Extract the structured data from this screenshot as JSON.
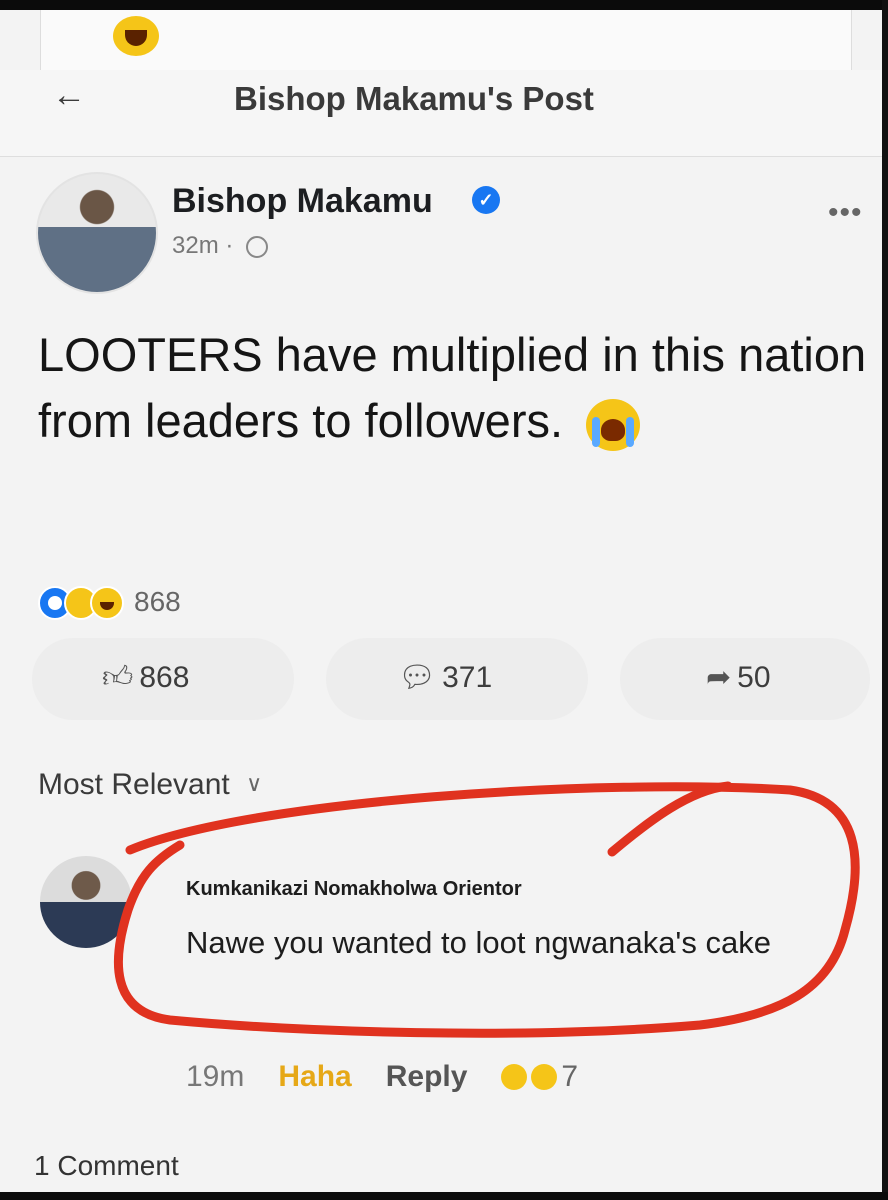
{
  "header": {
    "title": "Bishop Makamu's Post"
  },
  "post": {
    "author": "Bishop Makamu",
    "time": "32m",
    "separator": "·",
    "text": "LOOTERS have multiplied in this nation from leaders to followers.",
    "reaction_count": "868",
    "actions": {
      "like_count": "868",
      "comment_count": "371",
      "share_count": "50"
    }
  },
  "comments_section": {
    "sort_label": "Most Relevant",
    "comment": {
      "author": "Kumkanikazi Nomakholwa Orientor",
      "text": "Nawe you wanted to loot ngwanaka's cake",
      "time": "19m",
      "haha_label": "Haha",
      "reply_label": "Reply",
      "reaction_count": "7"
    },
    "total_label": "1 Comment"
  },
  "colors": {
    "accent": "#1877f2",
    "highlight": "#e0321f",
    "haha": "#e6a817"
  }
}
